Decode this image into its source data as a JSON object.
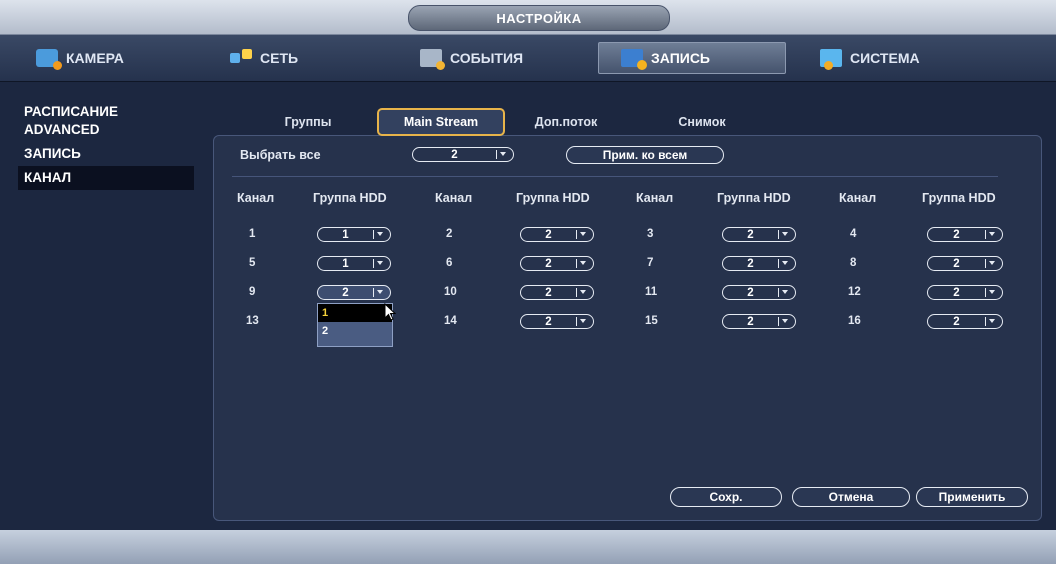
{
  "window": {
    "title": "НАСТРОЙКА"
  },
  "main_tabs": [
    {
      "label": "КАМЕРА",
      "icon": "camera-icon"
    },
    {
      "label": "СЕТЬ",
      "icon": "network-icon"
    },
    {
      "label": "СОБЫТИЯ",
      "icon": "events-icon"
    },
    {
      "label": "ЗАПИСЬ",
      "icon": "record-icon",
      "active": true
    },
    {
      "label": "СИСТЕМА",
      "icon": "system-icon"
    }
  ],
  "sidebar": {
    "items": [
      {
        "label": "РАСПИСАНИЕ"
      },
      {
        "label": "ADVANCED"
      },
      {
        "label": "ЗАПИСЬ"
      },
      {
        "label": "КАНАЛ",
        "active": true
      }
    ]
  },
  "sub_tabs": [
    {
      "label": "Группы"
    },
    {
      "label": "Main Stream",
      "active": true
    },
    {
      "label": "Доп.поток"
    },
    {
      "label": "Снимок"
    }
  ],
  "select_all": {
    "label": "Выбрать все",
    "value": "2",
    "apply_all_label": "Прим. ко всем"
  },
  "table": {
    "header_channel": "Канал",
    "header_group": "Группа HDD",
    "rows": [
      [
        {
          "ch": "1",
          "grp": "1"
        },
        {
          "ch": "2",
          "grp": "2"
        },
        {
          "ch": "3",
          "grp": "2"
        },
        {
          "ch": "4",
          "grp": "2"
        }
      ],
      [
        {
          "ch": "5",
          "grp": "1"
        },
        {
          "ch": "6",
          "grp": "2"
        },
        {
          "ch": "7",
          "grp": "2"
        },
        {
          "ch": "8",
          "grp": "2"
        }
      ],
      [
        {
          "ch": "9",
          "grp": "2"
        },
        {
          "ch": "10",
          "grp": "2"
        },
        {
          "ch": "11",
          "grp": "2"
        },
        {
          "ch": "12",
          "grp": "2"
        }
      ],
      [
        {
          "ch": "13",
          "grp": ""
        },
        {
          "ch": "14",
          "grp": "2"
        },
        {
          "ch": "15",
          "grp": "2"
        },
        {
          "ch": "16",
          "grp": "2"
        }
      ]
    ]
  },
  "dropdown": {
    "options": [
      "1",
      "2"
    ],
    "highlighted": "1"
  },
  "buttons": {
    "save": "Сохр.",
    "cancel": "Отмена",
    "apply": "Применить"
  }
}
